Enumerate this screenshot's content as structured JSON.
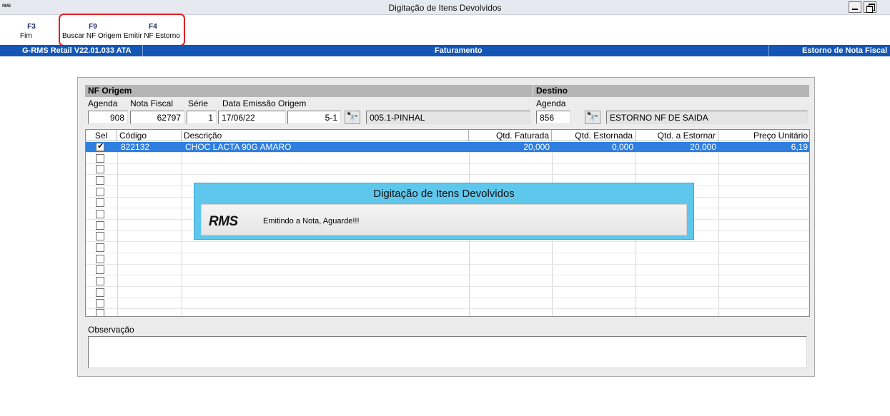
{
  "window": {
    "app_icon_text": "RMS",
    "title": "Digitação de Itens Devolvidos"
  },
  "toolbar": [
    {
      "key": "F3",
      "label": "Fim"
    },
    {
      "key": "F9",
      "label": "Buscar NF Origem"
    },
    {
      "key": "F4",
      "label": "Emitir NF Estorno"
    }
  ],
  "statusbar": {
    "version": "G-RMS Retail V22.01.033 ATA",
    "module": "Faturamento",
    "screen": "Estorno de Nota Fiscal",
    "bg_color": "#1356b5"
  },
  "origem": {
    "header": "NF Origem",
    "labels": {
      "agenda": "Agenda",
      "nota_fiscal": "Nota Fiscal",
      "serie": "Série",
      "data_emissao": "Data Emissão Origem"
    },
    "agenda": "908",
    "nota_fiscal": "62797",
    "serie": "1",
    "data_emissao": "17/06/22",
    "loja_codigo": "5-1",
    "loja_nome": "005.1-PINHAL"
  },
  "destino": {
    "header": "Destino",
    "agenda_label": "Agenda",
    "agenda": "856",
    "descricao": "ESTORNO NF DE SAIDA"
  },
  "grid": {
    "columns": [
      "Sel",
      "Código",
      "Descrição",
      "Qtd. Faturada",
      "Qtd. Estornada",
      "Qtd. a Estornar",
      "Preço Unitário"
    ],
    "rows": [
      {
        "checked": true,
        "codigo": "822132",
        "descricao": "CHOC LACTA 90G AMARO",
        "qtd_faturada": "20,000",
        "qtd_estornada": "0,000",
        "qtd_estornar": "20,000",
        "preco": "6,19"
      }
    ],
    "empty_rows": 15
  },
  "observacao": {
    "label": "Observação",
    "value": ""
  },
  "dialog": {
    "title": "Digitação de Itens Devolvidos",
    "logo": "RMS",
    "message": "Emitindo a Nota, Aguarde!!!"
  }
}
